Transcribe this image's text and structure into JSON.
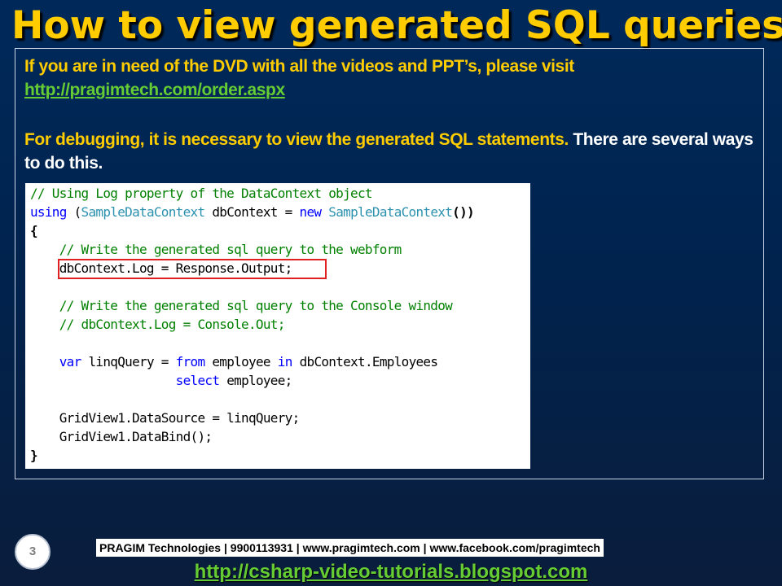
{
  "slide": {
    "title": "How to view generated SQL queries",
    "number": "3",
    "intro_text": "If you are in need of the DVD with all the videos and PPT’s, please visit",
    "intro_link": "http://pragimtech.com/order.aspx",
    "body_text_yellow": "For debugging, it is necessary to view the generated SQL statements.",
    "body_text_white": " There are several ways to do this.",
    "footer_text": "PRAGIM Technologies | 9900113931 | www.pragimtech.com | www.facebook.com/pragimtech",
    "footer_link": "http://csharp-video-tutorials.blogspot.com"
  },
  "code": {
    "l1": "// Using Log property of the DataContext object",
    "l2_kw": "using",
    "l2_a": " (",
    "l2_type1": "SampleDataContext",
    "l2_b": " dbContext = ",
    "l2_kw2": "new",
    "l2_c": " ",
    "l2_type2": "SampleDataContext",
    "l2_d": "())",
    "l3": "{",
    "l4": "    // Write the generated sql query to the webform",
    "l5": "    dbContext.Log = Response.Output;",
    "l7": "    // Write the generated sql query to the Console window",
    "l8": "    // dbContext.Log = Console.Out;",
    "l10_indent": "    ",
    "l10_kw": "var",
    "l10_a": " linqQuery = ",
    "l10_kw2": "from",
    "l10_b": " employee ",
    "l10_kw3": "in",
    "l10_c": " dbContext.Employees",
    "l11_indent": "                    ",
    "l11_kw": "select",
    "l11_a": " employee;",
    "l13": "    GridView1.DataSource = linqQuery;",
    "l14": "    GridView1.DataBind();",
    "l15": "}"
  },
  "colors": {
    "title": "#ffcc00",
    "body_text": "#ffcc00",
    "link": "#66cc33",
    "comment": "#008000",
    "keyword": "#0000ff",
    "type": "#2b91af",
    "highlight": "#e02020"
  }
}
